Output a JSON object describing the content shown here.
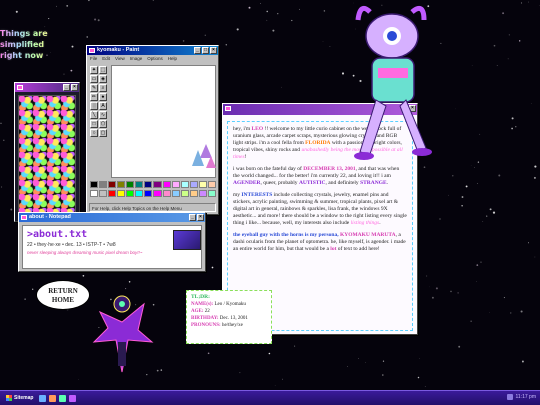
{
  "header": {
    "lines": [
      "Things are",
      "simplified",
      "right now"
    ]
  },
  "paint_window": {
    "title": "kyomaku - Paint",
    "menu": [
      "File",
      "Edit",
      "View",
      "Image",
      "Options",
      "Help"
    ],
    "status": "For Help, click Help Topics on the Help Menu",
    "palette": [
      "#000000",
      "#808080",
      "#800000",
      "#808000",
      "#008000",
      "#008080",
      "#000080",
      "#800080",
      "#ff00ff",
      "#ffaaff",
      "#aaffff",
      "#aaaaff",
      "#ffffaa",
      "#ffccaa",
      "#ffffff",
      "#c0c0c0",
      "#ff0000",
      "#ffff00",
      "#00ff00",
      "#00ffff",
      "#0000ff",
      "#ff00ff",
      "#ff88cc",
      "#88ccff",
      "#ccff88",
      "#ffcc88",
      "#cc88ff",
      "#88ffcc"
    ]
  },
  "notepad_window": {
    "title": "about - Notepad",
    "heading": ">about.txt",
    "meta": "22 • they·he·xe • dec. 13 • ISTP-T • 7w8",
    "footer": "never sleeping always dreaming music pixel dream boy!!~"
  },
  "main_window": {
    "title": "",
    "p1": [
      {
        "t": "hey, i'm "
      },
      {
        "t": "LEO",
        "c": "hl"
      },
      {
        "t": " !! welcome to my little curio cabinet on the web, chock full of uranium glass, arcade carpet scraps, mysterious glowing crystals and RGB light strips. i'm a cool fella from "
      },
      {
        "t": "FLORIDA",
        "c": "ho"
      },
      {
        "t": " with a passion for bright colors, tropical vibes, shiny rocks and "
      },
      {
        "t": "unabashedly being the most me possible at all times",
        "c": "hpk"
      },
      {
        "t": "!"
      }
    ],
    "p2": [
      {
        "t": "i was born on the fateful day of "
      },
      {
        "t": "DECEMBER 13, 2001",
        "c": "hl"
      },
      {
        "t": ", and that was when the world changed... for the better! i'm currently 22, and loving it!! i am "
      },
      {
        "t": "AGENDER",
        "c": "hpu"
      },
      {
        "t": ", queer, probably "
      },
      {
        "t": "AUTISTIC",
        "c": "hpu"
      },
      {
        "t": ", and definitely "
      },
      {
        "t": "STRANGE",
        "c": "hpu"
      },
      {
        "t": "."
      }
    ],
    "p3": [
      {
        "t": "my "
      },
      {
        "t": "INTERESTS",
        "c": "hb"
      },
      {
        "t": " include collecting crystals, jewelry, enamel pins and stickers, acrylic painting, swimming & summer, tropical plants, pixel art & digital art in general, rainbows & sparkles, lisa frank, the windows 9X aesthetic... and more! there should be a window to the right listing every single thing i like... because, well, my interests also include "
      },
      {
        "t": "listing things",
        "c": "hpk"
      },
      {
        "t": "."
      }
    ],
    "p4": [
      {
        "t": "the eyeball guy with the horns is my persona, ",
        "c": "hb"
      },
      {
        "t": "KYOMAKU MARUTA",
        "c": "hl"
      },
      {
        "t": ", a dashi ocularis from the planet of optometra. he, like myself, is agender. i made an entire world for him, but that would be a "
      },
      {
        "t": "lot",
        "c": "hl"
      },
      {
        "t": " of text to add here!"
      }
    ]
  },
  "tldr": {
    "heading": "TL;DR:",
    "rows": [
      {
        "label": "NAME(s):",
        "value": "Leo / Kyomaku"
      },
      {
        "label": "AGE:",
        "value": "22"
      },
      {
        "label": "BIRTHDAY:",
        "value": "Dec. 13, 2001"
      },
      {
        "label": "PRONOUNS:",
        "value": "he/they/xe"
      }
    ]
  },
  "return_home": {
    "line1": "RETURN",
    "line2": "HOME"
  },
  "taskbar": {
    "start_label": "Sitemap",
    "clock": "11:17 pm"
  }
}
